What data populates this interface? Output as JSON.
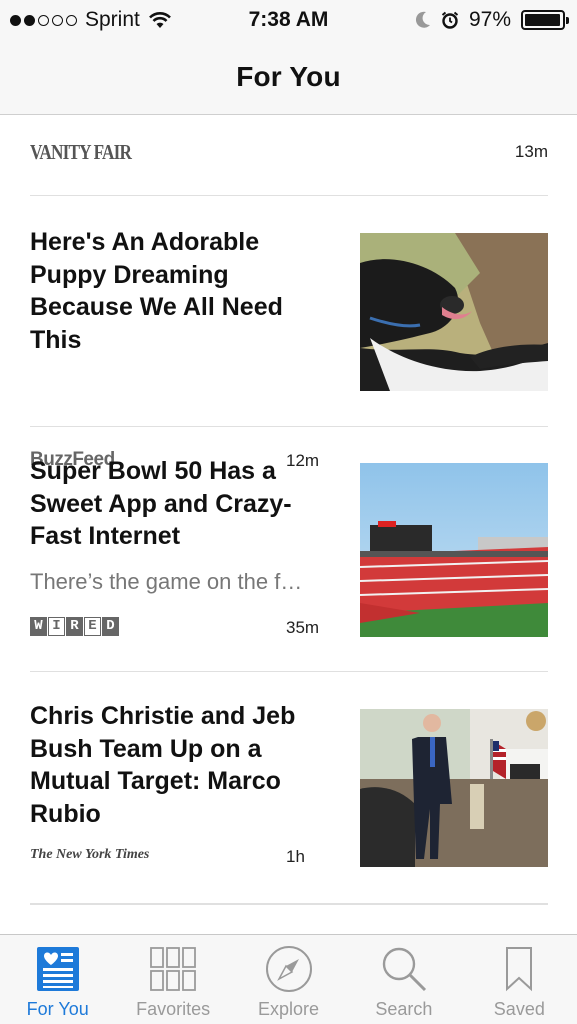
{
  "status_bar": {
    "carrier": "Sprint",
    "time": "7:38 AM",
    "battery": "97%",
    "battery_level": 0.97
  },
  "nav": {
    "title": "For You"
  },
  "feed": {
    "top_stub": {
      "source": "VANITY FAIR",
      "time": "13m"
    },
    "articles": [
      {
        "headline": "Here's An Adorable Puppy Dreaming Because We All Need This",
        "excerpt": "",
        "source": "BuzzFeed",
        "source_logo": "buzzfeed-logo",
        "time": "12m",
        "thumb": "puppy-photo"
      },
      {
        "headline": "Super Bowl 50 Has a Sweet App and Crazy-Fast Internet",
        "excerpt": "There’s the game on the f…",
        "source": "WIRED",
        "source_logo": "wired-logo",
        "time": "35m",
        "thumb": "stadium-photo"
      },
      {
        "headline": "Chris Christie and Jeb Bush Team Up on a Mutual Target: Marco Rubio",
        "excerpt": "",
        "source": "The New York Times",
        "source_logo": "nyt-logo",
        "time": "1h",
        "thumb": "speaker-photo"
      }
    ]
  },
  "tabbar": {
    "accent": "#1e7ad9",
    "inactive_color": "#9a9a9a",
    "tabs": [
      {
        "label": "For You",
        "icon": "for-you-icon",
        "active": true
      },
      {
        "label": "Favorites",
        "icon": "favorites-grid-icon",
        "active": false
      },
      {
        "label": "Explore",
        "icon": "compass-icon",
        "active": false
      },
      {
        "label": "Search",
        "icon": "search-icon",
        "active": false
      },
      {
        "label": "Saved",
        "icon": "bookmark-icon",
        "active": false
      }
    ]
  }
}
